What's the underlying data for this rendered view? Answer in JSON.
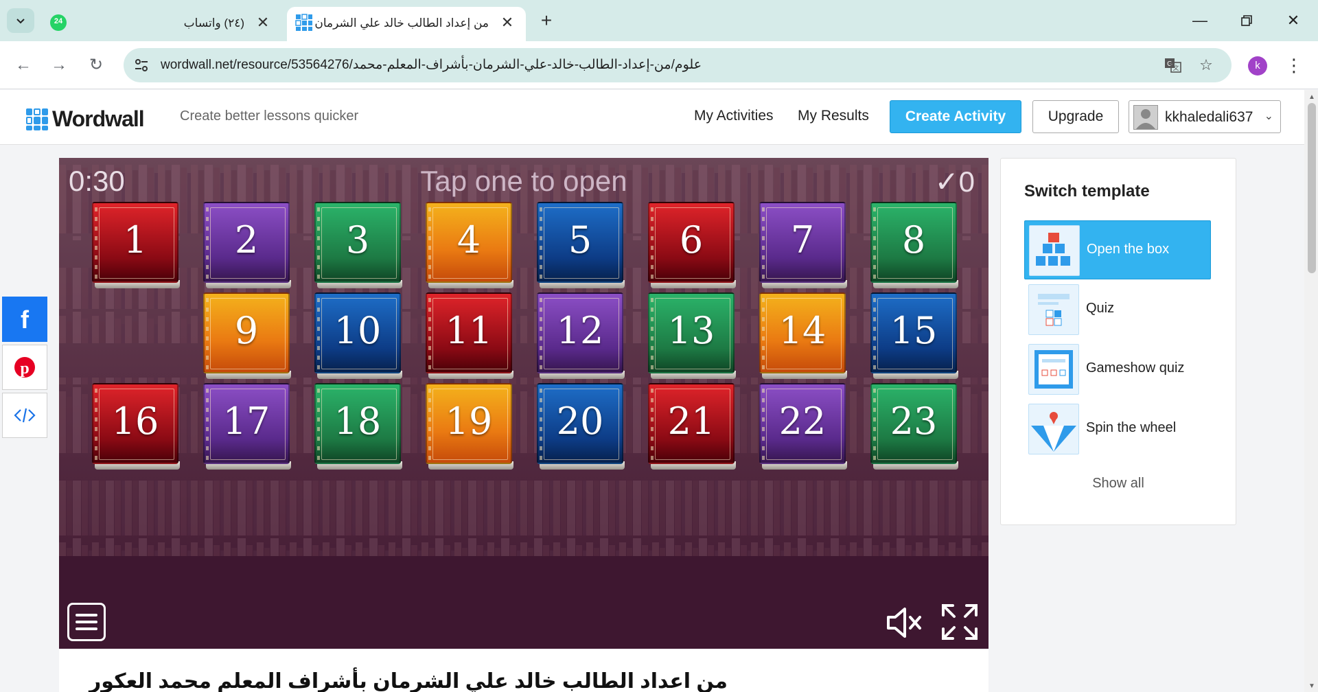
{
  "browser": {
    "tabs": [
      {
        "title": "(٢٤) واتساب",
        "badge": "24",
        "active": false
      },
      {
        "title": "من إعداد الطالب خالد علي الشرمان",
        "active": true
      }
    ],
    "url": "wordwall.net/resource/53564276/علوم/من-إعداد-الطالب-خالد-علي-الشرمان-بأشراف-المعلم-محمد",
    "profile_initial": "k"
  },
  "site": {
    "brand": "Wordwall",
    "tagline": "Create better lessons quicker",
    "nav": {
      "my_activities": "My Activities",
      "my_results": "My Results",
      "create_activity": "Create Activity",
      "upgrade": "Upgrade",
      "username": "kkhaledali637"
    }
  },
  "game": {
    "timer": "0:30",
    "instruction": "Tap one to open",
    "score": "0",
    "boxes": [
      {
        "label": "1",
        "color": "red"
      },
      {
        "label": "2",
        "color": "purple"
      },
      {
        "label": "3",
        "color": "green"
      },
      {
        "label": "4",
        "color": "orange"
      },
      {
        "label": "5",
        "color": "blue"
      },
      {
        "label": "6",
        "color": "red"
      },
      {
        "label": "7",
        "color": "purple"
      },
      {
        "label": "8",
        "color": "green"
      },
      {
        "label": "9",
        "color": "orange"
      },
      {
        "label": "10",
        "color": "blue"
      },
      {
        "label": "11",
        "color": "red"
      },
      {
        "label": "12",
        "color": "purple"
      },
      {
        "label": "13",
        "color": "green"
      },
      {
        "label": "14",
        "color": "orange"
      },
      {
        "label": "15",
        "color": "blue"
      },
      {
        "label": "16",
        "color": "red"
      },
      {
        "label": "17",
        "color": "purple"
      },
      {
        "label": "18",
        "color": "green"
      },
      {
        "label": "19",
        "color": "orange"
      },
      {
        "label": "20",
        "color": "blue"
      },
      {
        "label": "21",
        "color": "red"
      },
      {
        "label": "22",
        "color": "purple"
      },
      {
        "label": "23",
        "color": "green"
      }
    ]
  },
  "activity_title": "من اعداد الطالب خالد علي الشرمان بأشراف المعلم محمد العكور",
  "switch_template": {
    "title": "Switch template",
    "items": [
      {
        "label": "Open the box",
        "selected": true,
        "icon": "open-the-box-icon"
      },
      {
        "label": "Quiz",
        "selected": false,
        "icon": "quiz-icon"
      },
      {
        "label": "Gameshow quiz",
        "selected": false,
        "icon": "gameshow-quiz-icon"
      },
      {
        "label": "Spin the wheel",
        "selected": false,
        "icon": "spin-the-wheel-icon"
      }
    ],
    "show_all": "Show all"
  },
  "share": [
    "facebook-icon",
    "pinterest-icon",
    "embed-icon"
  ],
  "colors": {
    "accent": "#33b3f0",
    "facebook": "#1877f2",
    "pinterest": "#e60023"
  }
}
